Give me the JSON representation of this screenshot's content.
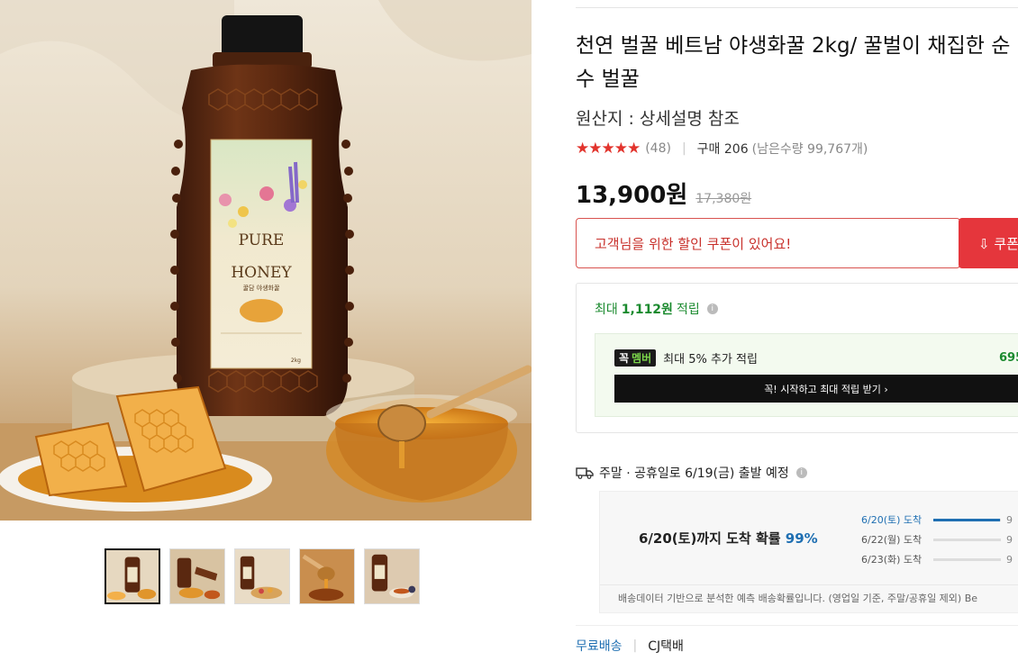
{
  "product": {
    "title": "천연 벌꿀 베트남 야생화꿀 2kg/ 꿀벌이 채집한 순수 벌꿀",
    "origin": "원산지 : 상세설명 참조",
    "stars": "★★★★★",
    "rating_count": "(48)",
    "purchase": "구매 206",
    "remaining": "(남은수량 99,767개)",
    "price": "13,900원",
    "original_price": "17,380원"
  },
  "label": {
    "brand_line1": "PURE",
    "brand_line2": "HONEY",
    "subtitle": "꿀담 야생화꿀",
    "weight": "2kg"
  },
  "coupon": {
    "text": "고객님을 위한 할인 쿠폰이 있어요!",
    "button": "⇩ 쿠폰"
  },
  "points": {
    "prefix": "최대",
    "amount": "1,112원",
    "suffix": "적립",
    "info_icon": "i",
    "member_logo_k": "꼭",
    "member_logo": "멤버",
    "member_text": "최대 5% 추가 적립",
    "member_extra": "695",
    "member_button": "꼭! 시작하고 최대 적립 받기 ›"
  },
  "shipping": {
    "text": "주말 · 공휴일로 6/19(금) 출발 예정",
    "info_icon": "i",
    "eta_text": "6/20(토)까지 도착 확률",
    "eta_pct": "99%",
    "eta_items": [
      {
        "label": "6/20(토) 도착",
        "tail": "9",
        "pct": 0.99
      },
      {
        "label": "6/22(월) 도착",
        "tail": "9",
        "pct": 0.0
      },
      {
        "label": "6/23(화) 도착",
        "tail": "9",
        "pct": 0.0
      }
    ],
    "note": "배송데이터 기반으로 분석한 예측 배송확률입니다. (영업일 기준, 주말/공휴일 제외) Be"
  },
  "delivery": {
    "free": "무료배송",
    "separator": "|",
    "carrier": "CJ택배"
  },
  "colors": {
    "accent_red": "#e5363c",
    "points_green": "#1a8a2e",
    "eta_blue": "#1f6fb2"
  },
  "icons": {
    "truck": "truck-icon",
    "info": "info-icon",
    "download": "download-icon"
  }
}
